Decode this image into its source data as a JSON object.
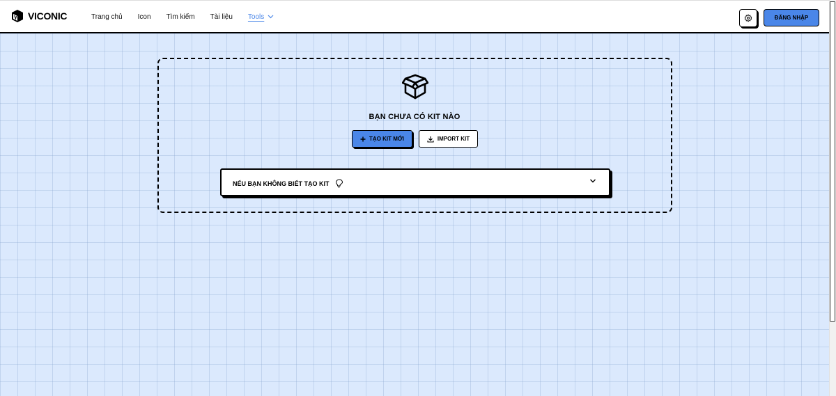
{
  "header": {
    "logo_text": "VICONIC",
    "nav": [
      {
        "label": "Trang chủ"
      },
      {
        "label": "Icon"
      },
      {
        "label": "Tìm kiếm"
      },
      {
        "label": "Tài liệu"
      },
      {
        "label": "Tools"
      }
    ],
    "active_nav": "Tools",
    "settings_icon": "gear-icon",
    "login_label": "ĐĂNG NHẬP"
  },
  "empty_state": {
    "icon": "box-icon",
    "title": "BẠN CHƯA CÓ KIT NÀO",
    "new_kit_label": "TẠO KIT MỚI",
    "import_kit_label": "IMPORT KIT"
  },
  "help": {
    "label": "NẾU BẠN KHÔNG BIẾT TẠO KIT",
    "icon": "lightbulb-icon"
  },
  "colors": {
    "accent": "#4a86e8",
    "background": "#dbe9fd"
  }
}
